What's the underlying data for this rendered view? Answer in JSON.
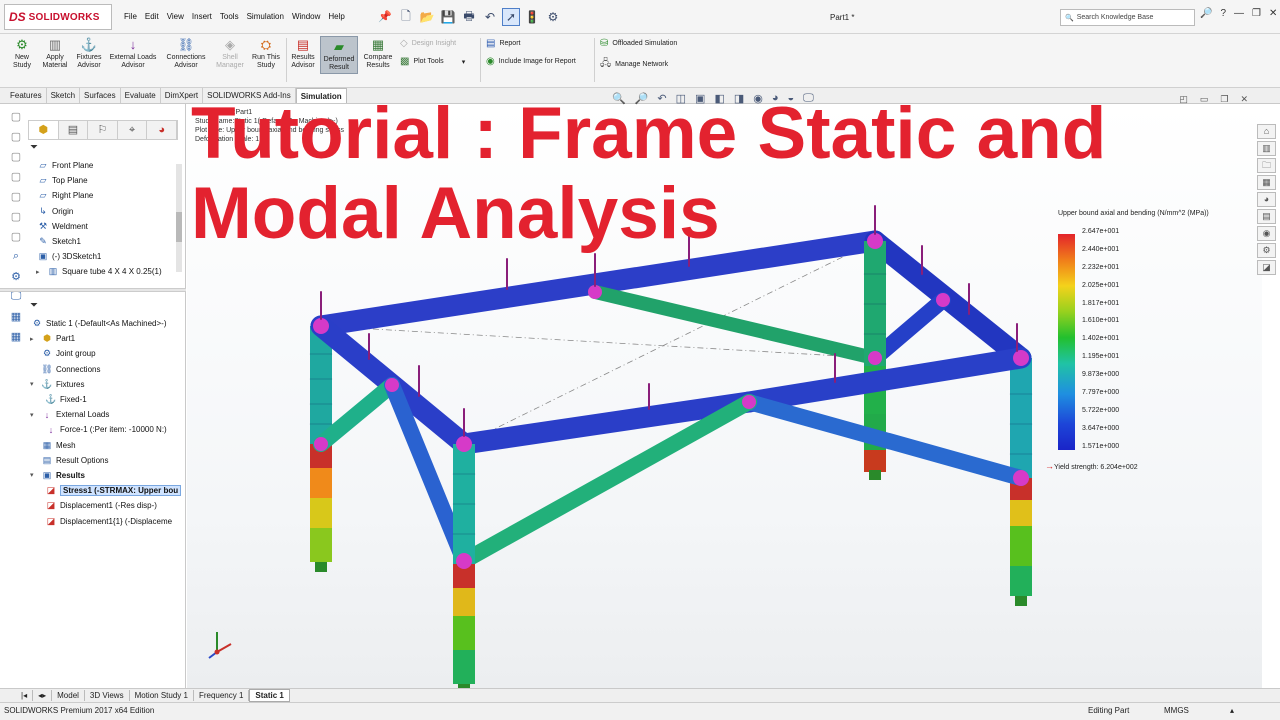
{
  "app": {
    "brand": "SOLIDWORKS",
    "doc_title": "Part1 *",
    "menu": [
      "File",
      "Edit",
      "View",
      "Insert",
      "Tools",
      "Simulation",
      "Window",
      "Help"
    ],
    "search_placeholder": "Search Knowledge Base",
    "quick_icons": [
      "new-doc-icon",
      "open-icon",
      "save-icon",
      "print-icon",
      "undo-icon",
      "select-arrow-icon",
      "rebuild-icon",
      "options-icon"
    ]
  },
  "ribbon": {
    "new_study": "New Study",
    "apply_material": "Apply Material",
    "fixtures_advisor": "Fixtures Advisor",
    "external_loads_advisor": "External Loads Advisor",
    "connections_advisor": "Connections Advisor",
    "shell_manager": "Shell Manager",
    "run_this_study": "Run This Study",
    "results_advisor": "Results Advisor",
    "deformed_result": "Deformed Result",
    "compare_results": "Compare Results",
    "design_insight": "Design Insight",
    "plot_tools": "Plot Tools",
    "report": "Report",
    "include_image": "Include Image for Report",
    "offloaded_simulation": "Offloaded Simulation",
    "manage_network": "Manage Network"
  },
  "tabs": [
    "Features",
    "Sketch",
    "Surfaces",
    "Evaluate",
    "DimXpert",
    "SOLIDWORKS Add-Ins",
    "Simulation"
  ],
  "feature_tree": [
    "Front Plane",
    "Top Plane",
    "Right Plane",
    "Origin",
    "Weldment",
    "Sketch1",
    "(-) 3DSketch1",
    "Square tube 4 X 4 X 0.25(1)"
  ],
  "study_tree": {
    "study": "Static 1 (-Default<As Machined>-)",
    "part": "Part1",
    "joint_group": "Joint group",
    "connections": "Connections",
    "fixtures": "Fixtures",
    "fixed": "Fixed-1",
    "external_loads": "External Loads",
    "force": "Force-1 (:Per item: -10000 N:)",
    "mesh": "Mesh",
    "result_options": "Result Options",
    "results": "Results",
    "stress": "Stress1 (-STRMAX: Upper bou",
    "displacement": "Displacement1 (-Res disp-)",
    "displacement2": "Displacement1{1} (-Displaceme"
  },
  "viewport": {
    "info_lines": [
      "Model name:Part1",
      "Study name:Static 1(-Default<As Machined>-)",
      "Plot type: Upper bound axial and bending stress",
      "Deformation scale: 1"
    ],
    "overlay_title_line1": "Tutorial : Frame Static and",
    "overlay_title_line2": "Modal Analysis",
    "legend_title": "Upper bound axial and bending (N/mm^2 (MPa))",
    "legend_values": [
      "2.647e+001",
      "2.440e+001",
      "2.232e+001",
      "2.025e+001",
      "1.817e+001",
      "1.610e+001",
      "1.402e+001",
      "1.195e+001",
      "9.873e+000",
      "7.797e+000",
      "5.722e+000",
      "3.647e+000",
      "1.571e+000"
    ],
    "yield_strength": "Yield strength: 6.204e+002",
    "legend_colors": [
      "#e3242b",
      "#f4d21b",
      "#22c02e",
      "#1f8fe0",
      "#1a24c8"
    ]
  },
  "bottom_tabs": [
    "Model",
    "3D Views",
    "Motion Study 1",
    "Frequency 1",
    "Static 1"
  ],
  "status": {
    "edition": "SOLIDWORKS Premium 2017 x64 Edition",
    "mode": "Editing Part",
    "units": "MMGS"
  }
}
